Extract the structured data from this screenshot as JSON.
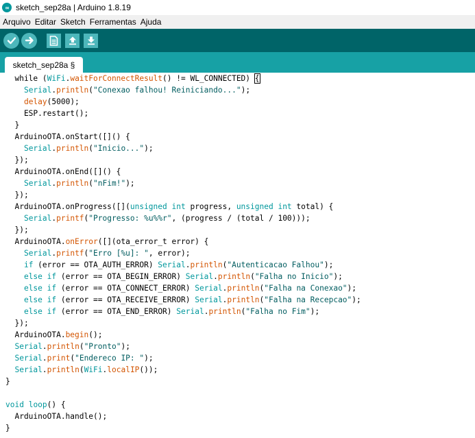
{
  "window": {
    "title": "sketch_sep28a | Arduino 1.8.19"
  },
  "menu": {
    "items": [
      "Arquivo",
      "Editar",
      "Sketch",
      "Ferramentas",
      "Ajuda"
    ]
  },
  "toolbar": {
    "buttons": [
      "verify-icon",
      "upload-icon",
      "new-icon",
      "open-icon",
      "save-icon"
    ]
  },
  "tabs": {
    "active": "sketch_sep28a §"
  },
  "colors": {
    "toolbar_bg": "#006468",
    "tabbar_bg": "#17a1a5",
    "button_bg": "#4db7bb",
    "keyword": "#00979c",
    "function": "#d35400",
    "string": "#005c5f"
  },
  "editor": {
    "lines": [
      [
        [
          "  while (",
          ""
        ],
        [
          "WiFi",
          "kw"
        ],
        [
          ".",
          ""
        ],
        [
          "waitForConnectResult",
          "fn"
        ],
        [
          "() != WL_CONNECTED) ",
          ""
        ],
        [
          "{",
          "cursor"
        ]
      ],
      [
        [
          "    ",
          ""
        ],
        [
          "Serial",
          "kw"
        ],
        [
          ".",
          ""
        ],
        [
          "println",
          "fn"
        ],
        [
          "(",
          ""
        ],
        [
          "\"Conexao falhou! Reiniciando...\"",
          "str"
        ],
        [
          ");",
          ""
        ]
      ],
      [
        [
          "    ",
          ""
        ],
        [
          "delay",
          "fn"
        ],
        [
          "(5000);",
          ""
        ]
      ],
      [
        [
          "    ESP.restart();",
          ""
        ]
      ],
      [
        [
          "  }",
          ""
        ]
      ],
      [
        [
          "  ArduinoOTA.onStart([]() {",
          ""
        ]
      ],
      [
        [
          "    ",
          ""
        ],
        [
          "Serial",
          "kw"
        ],
        [
          ".",
          ""
        ],
        [
          "println",
          "fn"
        ],
        [
          "(",
          ""
        ],
        [
          "\"Inicio...\"",
          "str"
        ],
        [
          ");",
          ""
        ]
      ],
      [
        [
          "  });",
          ""
        ]
      ],
      [
        [
          "  ArduinoOTA.onEnd([]() {",
          ""
        ]
      ],
      [
        [
          "    ",
          ""
        ],
        [
          "Serial",
          "kw"
        ],
        [
          ".",
          ""
        ],
        [
          "println",
          "fn"
        ],
        [
          "(",
          ""
        ],
        [
          "\"nFim!\"",
          "str"
        ],
        [
          ");",
          ""
        ]
      ],
      [
        [
          "  });",
          ""
        ]
      ],
      [
        [
          "  ArduinoOTA.onProgress([](",
          ""
        ],
        [
          "unsigned",
          "kw"
        ],
        [
          " ",
          ""
        ],
        [
          "int",
          "kw"
        ],
        [
          " progress, ",
          ""
        ],
        [
          "unsigned",
          "kw"
        ],
        [
          " ",
          ""
        ],
        [
          "int",
          "kw"
        ],
        [
          " total) {",
          ""
        ]
      ],
      [
        [
          "    ",
          ""
        ],
        [
          "Serial",
          "kw"
        ],
        [
          ".",
          ""
        ],
        [
          "printf",
          "fn"
        ],
        [
          "(",
          ""
        ],
        [
          "\"Progresso: %u%%r\"",
          "str"
        ],
        [
          ", (progress / (total / 100)));",
          ""
        ]
      ],
      [
        [
          "  });",
          ""
        ]
      ],
      [
        [
          "  ArduinoOTA.",
          ""
        ],
        [
          "onError",
          "fn"
        ],
        [
          "([](ota_error_t error) {",
          ""
        ]
      ],
      [
        [
          "    ",
          ""
        ],
        [
          "Serial",
          "kw"
        ],
        [
          ".",
          ""
        ],
        [
          "printf",
          "fn"
        ],
        [
          "(",
          ""
        ],
        [
          "\"Erro [%u]: \"",
          "str"
        ],
        [
          ", error);",
          ""
        ]
      ],
      [
        [
          "    ",
          ""
        ],
        [
          "if",
          "kw"
        ],
        [
          " (error == OTA_AUTH_ERROR) ",
          ""
        ],
        [
          "Serial",
          "kw"
        ],
        [
          ".",
          ""
        ],
        [
          "println",
          "fn"
        ],
        [
          "(",
          ""
        ],
        [
          "\"Autenticacao Falhou\"",
          "str"
        ],
        [
          ");",
          ""
        ]
      ],
      [
        [
          "    ",
          ""
        ],
        [
          "else",
          "kw"
        ],
        [
          " ",
          ""
        ],
        [
          "if",
          "kw"
        ],
        [
          " (error == OTA_BEGIN_ERROR) ",
          ""
        ],
        [
          "Serial",
          "kw"
        ],
        [
          ".",
          ""
        ],
        [
          "println",
          "fn"
        ],
        [
          "(",
          ""
        ],
        [
          "\"Falha no Inicio\"",
          "str"
        ],
        [
          ");",
          ""
        ]
      ],
      [
        [
          "    ",
          ""
        ],
        [
          "else",
          "kw"
        ],
        [
          " ",
          ""
        ],
        [
          "if",
          "kw"
        ],
        [
          " (error == OTA_CONNECT_ERROR) ",
          ""
        ],
        [
          "Serial",
          "kw"
        ],
        [
          ".",
          ""
        ],
        [
          "println",
          "fn"
        ],
        [
          "(",
          ""
        ],
        [
          "\"Falha na Conexao\"",
          "str"
        ],
        [
          ");",
          ""
        ]
      ],
      [
        [
          "    ",
          ""
        ],
        [
          "else",
          "kw"
        ],
        [
          " ",
          ""
        ],
        [
          "if",
          "kw"
        ],
        [
          " (error == OTA_RECEIVE_ERROR) ",
          ""
        ],
        [
          "Serial",
          "kw"
        ],
        [
          ".",
          ""
        ],
        [
          "println",
          "fn"
        ],
        [
          "(",
          ""
        ],
        [
          "\"Falha na Recepcao\"",
          "str"
        ],
        [
          ");",
          ""
        ]
      ],
      [
        [
          "    ",
          ""
        ],
        [
          "else",
          "kw"
        ],
        [
          " ",
          ""
        ],
        [
          "if",
          "kw"
        ],
        [
          " (error == OTA_END_ERROR) ",
          ""
        ],
        [
          "Serial",
          "kw"
        ],
        [
          ".",
          ""
        ],
        [
          "println",
          "fn"
        ],
        [
          "(",
          ""
        ],
        [
          "\"Falha no Fim\"",
          "str"
        ],
        [
          ");",
          ""
        ]
      ],
      [
        [
          "  });",
          ""
        ]
      ],
      [
        [
          "  ArduinoOTA.",
          ""
        ],
        [
          "begin",
          "fn"
        ],
        [
          "();",
          ""
        ]
      ],
      [
        [
          "  ",
          ""
        ],
        [
          "Serial",
          "kw"
        ],
        [
          ".",
          ""
        ],
        [
          "println",
          "fn"
        ],
        [
          "(",
          ""
        ],
        [
          "\"Pronto\"",
          "str"
        ],
        [
          ");",
          ""
        ]
      ],
      [
        [
          "  ",
          ""
        ],
        [
          "Serial",
          "kw"
        ],
        [
          ".",
          ""
        ],
        [
          "print",
          "fn"
        ],
        [
          "(",
          ""
        ],
        [
          "\"Endereco IP: \"",
          "str"
        ],
        [
          ");",
          ""
        ]
      ],
      [
        [
          "  ",
          ""
        ],
        [
          "Serial",
          "kw"
        ],
        [
          ".",
          ""
        ],
        [
          "println",
          "fn"
        ],
        [
          "(",
          ""
        ],
        [
          "WiFi",
          "kw"
        ],
        [
          ".",
          ""
        ],
        [
          "localIP",
          "fn"
        ],
        [
          "());",
          ""
        ]
      ],
      [
        [
          "}",
          ""
        ]
      ],
      [
        [
          "",
          ""
        ]
      ],
      [
        [
          "",
          ""
        ],
        [
          "void",
          "kw"
        ],
        [
          " ",
          ""
        ],
        [
          "loop",
          "kw"
        ],
        [
          "() {",
          ""
        ]
      ],
      [
        [
          "  ArduinoOTA.handle();",
          ""
        ]
      ],
      [
        [
          "}",
          ""
        ]
      ]
    ]
  }
}
